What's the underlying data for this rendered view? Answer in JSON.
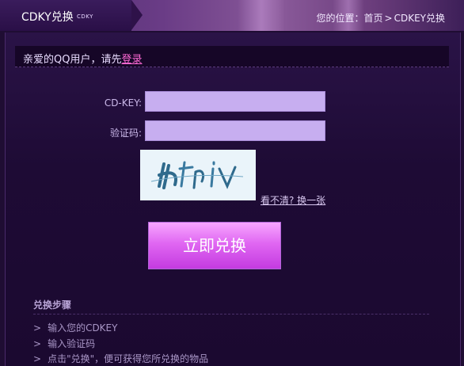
{
  "header": {
    "title": "CDKY兑换",
    "subtitle": "CDKY",
    "breadcrumb": {
      "prefix": "您的位置：",
      "home": "首页",
      "separator": ">",
      "current": "CDKEY兑换"
    }
  },
  "login_bar": {
    "text": "亲爱的QQ用户，请先",
    "link": "登录"
  },
  "form": {
    "cdkey_label": "CD-KEY:",
    "cdkey_value": "",
    "captcha_label": "验证码:",
    "captcha_value": "",
    "captcha_text": "lhtiv",
    "refresh_link": "看不清? 换一张",
    "submit_label": "立即兑换"
  },
  "steps": {
    "title": "兑换步骤",
    "items": [
      "输入您的CDKEY",
      "输入验证码",
      "点击\"兑换\"，便可获得您所兑换的物品"
    ],
    "bullet": ">"
  },
  "colors": {
    "accent": "#ff6ad6",
    "button_top": "#f7a6ff",
    "button_bottom": "#c43be0",
    "input_bg": "#c7aef0",
    "background": "#1f0d33"
  }
}
